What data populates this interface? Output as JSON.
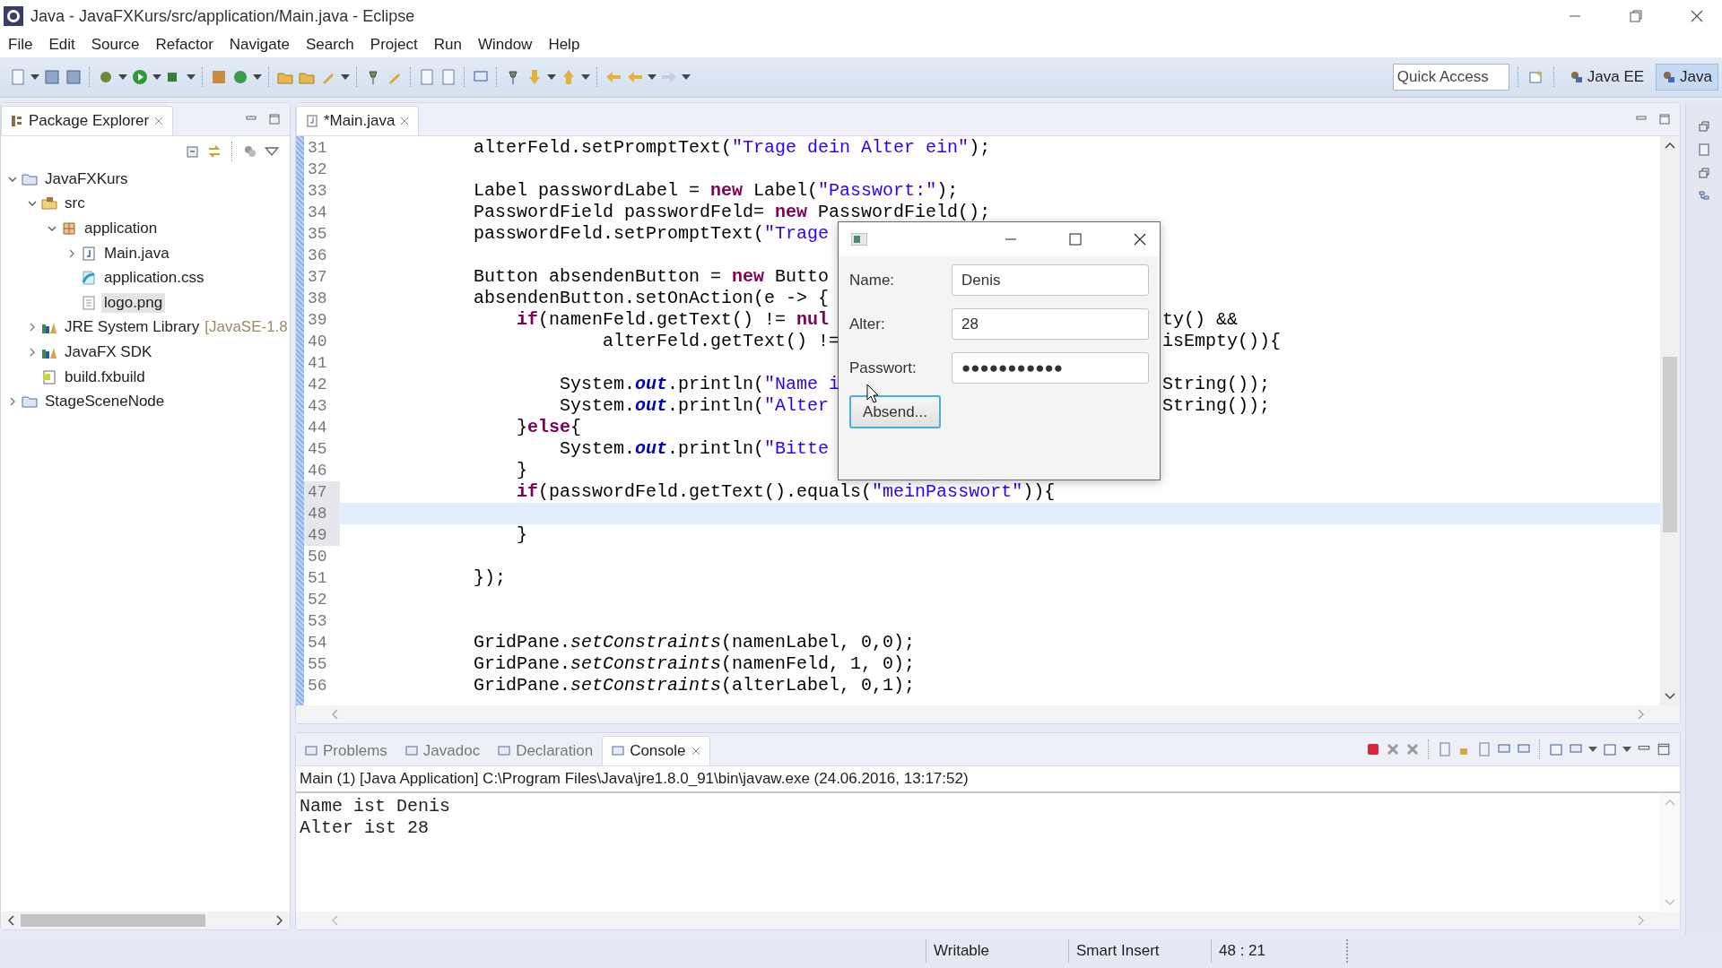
{
  "window": {
    "title": "Java - JavaFXKurs/src/application/Main.java - Eclipse"
  },
  "menu": [
    "File",
    "Edit",
    "Source",
    "Refactor",
    "Navigate",
    "Search",
    "Project",
    "Run",
    "Window",
    "Help"
  ],
  "quick_access": {
    "placeholder": "Quick Access"
  },
  "perspectives": [
    {
      "label": "Java EE",
      "selected": false
    },
    {
      "label": "Java",
      "selected": true
    }
  ],
  "package_explorer": {
    "title": "Package Explorer",
    "tree": [
      {
        "label": "JavaFXKurs",
        "kind": "project",
        "expanded": true,
        "selected": false,
        "children": [
          {
            "label": "src",
            "kind": "source-folder",
            "expanded": true,
            "selected": false,
            "children": [
              {
                "label": "application",
                "kind": "package",
                "expanded": true,
                "selected": false,
                "children": [
                  {
                    "label": "Main.java",
                    "kind": "java-file",
                    "expanded": false,
                    "selected": false
                  },
                  {
                    "label": "application.css",
                    "kind": "css-file",
                    "selected": false
                  },
                  {
                    "label": "logo.png",
                    "kind": "file",
                    "selected": true
                  }
                ]
              }
            ]
          },
          {
            "label": "JRE System Library",
            "suffix": "[JavaSE-1.8",
            "kind": "library",
            "expanded": false,
            "selected": false
          },
          {
            "label": "JavaFX SDK",
            "kind": "library",
            "expanded": false,
            "selected": false
          },
          {
            "label": "build.fxbuild",
            "kind": "build-file",
            "selected": false
          }
        ]
      },
      {
        "label": "StageSceneNode",
        "kind": "project",
        "expanded": false,
        "selected": false
      }
    ]
  },
  "editor": {
    "tab": "*Main.java",
    "lines": [
      {
        "number": "31",
        "current": false,
        "changed": false,
        "tokens": [
          {
            "kind": "plain",
            "text": "            alterFeld.setPromptText("
          },
          {
            "kind": "string",
            "text": "\"Trage dein Alter ein\""
          },
          {
            "kind": "plain",
            "text": ");"
          }
        ]
      },
      {
        "number": "32",
        "current": false,
        "changed": false
      },
      {
        "number": "33",
        "current": false,
        "changed": false,
        "tokens": [
          {
            "kind": "plain",
            "text": "            Label passwordLabel = "
          },
          {
            "kind": "keyword",
            "text": "new"
          },
          {
            "kind": "plain",
            "text": " Label("
          },
          {
            "kind": "string",
            "text": "\"Passwort:\""
          },
          {
            "kind": "plain",
            "text": ");"
          }
        ]
      },
      {
        "number": "34",
        "current": false,
        "changed": false,
        "tokens": [
          {
            "kind": "plain",
            "text": "            PasswordField passwordFeld= "
          },
          {
            "kind": "keyword",
            "text": "new"
          },
          {
            "kind": "plain",
            "text": " PasswordField();"
          }
        ]
      },
      {
        "number": "35",
        "current": false,
        "changed": false,
        "tokens": [
          {
            "kind": "plain",
            "text": "            passwordFeld.setPromptText("
          },
          {
            "kind": "string",
            "text": "\"Trage"
          }
        ]
      },
      {
        "number": "36",
        "current": false,
        "changed": false
      },
      {
        "number": "37",
        "current": false,
        "changed": false,
        "tokens": [
          {
            "kind": "plain",
            "text": "            Button absendenButton = "
          },
          {
            "kind": "keyword",
            "text": "new"
          },
          {
            "kind": "plain",
            "text": " Butto"
          }
        ]
      },
      {
        "number": "38",
        "current": false,
        "changed": false,
        "tokens": [
          {
            "kind": "plain",
            "text": "            absendenButton.setOnAction(e -> {"
          }
        ]
      },
      {
        "number": "39",
        "current": false,
        "changed": false,
        "tokens": [
          {
            "kind": "keyword",
            "text": "                if"
          },
          {
            "kind": "plain",
            "text": "(namenFeld.getText() != "
          },
          {
            "kind": "keyword",
            "text": "nul"
          }
        ],
        "tail": "ty() &&"
      },
      {
        "number": "40",
        "current": false,
        "changed": false,
        "tokens": [
          {
            "kind": "plain",
            "text": "                        alterFeld.getText() !="
          }
        ],
        "tail": "isEmpty()){"
      },
      {
        "number": "41",
        "current": false,
        "changed": false
      },
      {
        "number": "42",
        "current": false,
        "changed": false,
        "tokens": [
          {
            "kind": "plain",
            "text": "                    System."
          },
          {
            "kind": "field",
            "text": "out"
          },
          {
            "kind": "plain",
            "text": ".println("
          },
          {
            "kind": "string",
            "text": "\"Name i"
          }
        ],
        "tail": "String());"
      },
      {
        "number": "43",
        "current": false,
        "changed": false,
        "tokens": [
          {
            "kind": "plain",
            "text": "                    System."
          },
          {
            "kind": "field",
            "text": "out"
          },
          {
            "kind": "plain",
            "text": ".println("
          },
          {
            "kind": "string",
            "text": "\"Alter"
          }
        ],
        "tail": "String());"
      },
      {
        "number": "44",
        "current": false,
        "changed": false,
        "tokens": [
          {
            "kind": "plain",
            "text": "                }"
          },
          {
            "kind": "keyword",
            "text": "else"
          },
          {
            "kind": "plain",
            "text": "{"
          }
        ]
      },
      {
        "number": "45",
        "current": false,
        "changed": false,
        "tokens": [
          {
            "kind": "plain",
            "text": "                    System."
          },
          {
            "kind": "field",
            "text": "out"
          },
          {
            "kind": "plain",
            "text": ".println("
          },
          {
            "kind": "string",
            "text": "\"Bitte"
          }
        ]
      },
      {
        "number": "46",
        "current": false,
        "changed": false,
        "tokens": [
          {
            "kind": "plain",
            "text": "                }"
          }
        ]
      },
      {
        "number": "47",
        "current": false,
        "changed": true,
        "tokens": [
          {
            "kind": "keyword",
            "text": "                if"
          },
          {
            "kind": "plain",
            "text": "(passwordFeld.getText().equals("
          },
          {
            "kind": "string",
            "text": "\"meinPasswort\""
          },
          {
            "kind": "plain",
            "text": ")){"
          }
        ]
      },
      {
        "number": "48",
        "current": true,
        "changed": true
      },
      {
        "number": "49",
        "current": false,
        "changed": true,
        "tokens": [
          {
            "kind": "plain",
            "text": "                }"
          }
        ]
      },
      {
        "number": "50",
        "current": false,
        "changed": false
      },
      {
        "number": "51",
        "current": false,
        "changed": false,
        "tokens": [
          {
            "kind": "plain",
            "text": "            });"
          }
        ]
      },
      {
        "number": "52",
        "current": false,
        "changed": false
      },
      {
        "number": "53",
        "current": false,
        "changed": false
      },
      {
        "number": "54",
        "current": false,
        "changed": false,
        "tokens": [
          {
            "kind": "plain",
            "text": "            GridPane."
          },
          {
            "kind": "static",
            "text": "setConstraints"
          },
          {
            "kind": "plain",
            "text": "(namenLabel, 0,0);"
          }
        ]
      },
      {
        "number": "55",
        "current": false,
        "changed": false,
        "tokens": [
          {
            "kind": "plain",
            "text": "            GridPane."
          },
          {
            "kind": "static",
            "text": "setConstraints"
          },
          {
            "kind": "plain",
            "text": "(namenFeld, 1, 0);"
          }
        ]
      },
      {
        "number": "56",
        "current": false,
        "changed": false,
        "tokens": [
          {
            "kind": "plain",
            "text": "            GridPane."
          },
          {
            "kind": "static",
            "text": "setConstraints"
          },
          {
            "kind": "plain",
            "text": "(alterLabel, 0,1);"
          }
        ]
      }
    ]
  },
  "dialog": {
    "fields": [
      {
        "label": "Name:",
        "value": "Denis"
      },
      {
        "label": "Alter:",
        "value": "28"
      },
      {
        "label": "Passwort:",
        "value": "●●●●●●●●●●●"
      }
    ],
    "button": "Absend..."
  },
  "bottom_panel": {
    "tabs": [
      {
        "label": "Problems",
        "selected": false
      },
      {
        "label": "Javadoc",
        "selected": false
      },
      {
        "label": "Declaration",
        "selected": false
      },
      {
        "label": "Console",
        "selected": true
      }
    ],
    "console_header": "Main (1) [Java Application] C:\\Program Files\\Java\\jre1.8.0_91\\bin\\javaw.exe (24.06.2016, 13:17:52)",
    "output": [
      "Name ist Denis",
      "Alter ist 28"
    ]
  },
  "status_bar": [
    "Writable",
    "Smart Insert",
    "48 : 21"
  ]
}
